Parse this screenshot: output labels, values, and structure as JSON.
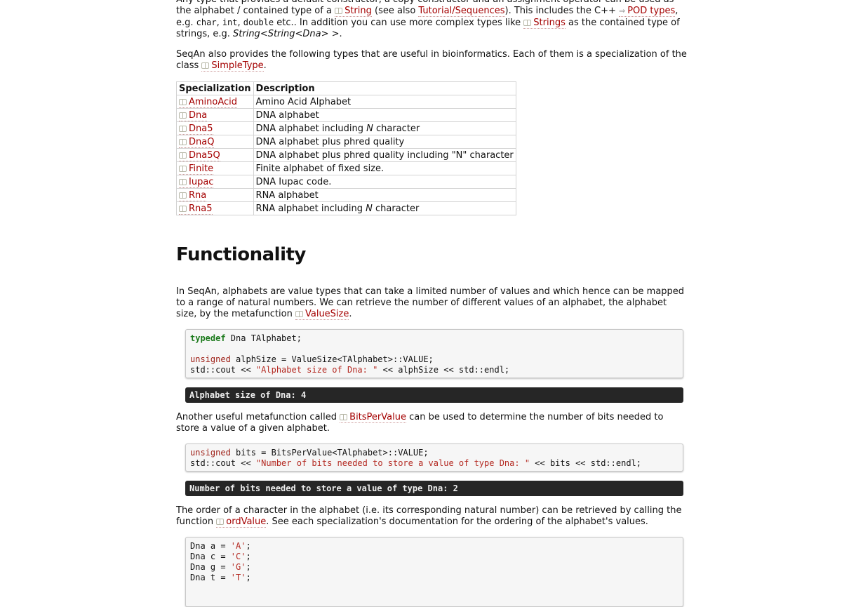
{
  "intro": {
    "p1_a": "Any type that provides a default constructor, a copy constructor and an assignment operator can be used as the alphabet / contained type of a ",
    "p1_string": "String",
    "p1_b": " (see also ",
    "p1_tutorial": "Tutorial/Sequences",
    "p1_c": "). This includes the C++ ",
    "p1_pod": "POD types",
    "p1_d": ", e.g. ",
    "p1_char": "char",
    "p1_sep1": ", ",
    "p1_int": "int",
    "p1_sep2": ", ",
    "p1_double": "double",
    "p1_e": " etc.. In addition you can use more complex types like ",
    "p1_strings": "Strings",
    "p1_f": " as the contained type of strings, e.g. ",
    "p1_example": "String<String<Dna> >",
    "p1_g": ".",
    "p2_a": "SeqAn also provides the following types that are useful in bioinformatics. Each of them is a specialization of the class ",
    "p2_simpletype": "SimpleType",
    "p2_b": "."
  },
  "table": {
    "headers": [
      "Specialization",
      "Description"
    ],
    "rows": [
      {
        "name": "AminoAcid",
        "desc": "Amino Acid Alphabet"
      },
      {
        "name": "Dna",
        "desc": "DNA alphabet"
      },
      {
        "name": "Dna5",
        "desc_a": "DNA alphabet including ",
        "desc_em": "N",
        "desc_b": " character"
      },
      {
        "name": "DnaQ",
        "desc": "DNA alphabet plus phred quality"
      },
      {
        "name": "Dna5Q",
        "desc": "DNA alphabet plus phred quality including \"N\" character"
      },
      {
        "name": "Finite",
        "desc": "Finite alphabet of fixed size."
      },
      {
        "name": "Iupac",
        "desc": "DNA Iupac code."
      },
      {
        "name": "Rna",
        "desc": "RNA alphabet"
      },
      {
        "name": "Rna5",
        "desc_a": "RNA alphabet including ",
        "desc_em": "N",
        "desc_b": " character"
      }
    ]
  },
  "functionality": {
    "heading": "Functionality",
    "p1_a": "In SeqAn, alphabets are value types that can take a limited number of values and which hence can be mapped to a range of natural numbers. We can retrieve the number of different values of an alphabet, the alphabet size, by the metafunction ",
    "p1_valuesize": "ValueSize",
    "p1_b": ".",
    "code1": {
      "l1_kw": "typedef",
      "l1_rest": " Dna TAlphabet;",
      "l3_kw": "unsigned",
      "l3_rest": " alphSize = ValueSize<TAlphabet>::VALUE;",
      "l4_a": "std::cout << ",
      "l4_str": "\"Alphabet size of Dna: \"",
      "l4_b": " << alphSize << std::endl;"
    },
    "out1": "Alphabet size of Dna: 4",
    "p2_a": "Another useful metafunction called ",
    "p2_bitspervalue": "BitsPerValue",
    "p2_b": " can be used to determine the number of bits needed to store a value of a given alphabet.",
    "code2": {
      "l1_kw": "unsigned",
      "l1_rest": " bits = BitsPerValue<TAlphabet>::VALUE;",
      "l2_a": "std::cout << ",
      "l2_str": "\"Number of bits needed to store a value of type Dna: \"",
      "l2_b": " << bits << std::endl;"
    },
    "out2": "Number of bits needed to store a value of type Dna: 2",
    "p3_a": "The order of a character in the alphabet (i.e. its corresponding natural number) can be retrieved by calling the function ",
    "p3_ordvalue": "ordValue",
    "p3_b": ". See each specialization's documentation for the ordering of the alphabet's values.",
    "code3": [
      {
        "a": "Dna a = ",
        "s": "'A'",
        "b": ";"
      },
      {
        "a": "Dna c = ",
        "s": "'C'",
        "b": ";"
      },
      {
        "a": "Dna g = ",
        "s": "'G'",
        "b": ";"
      },
      {
        "a": "Dna t = ",
        "s": "'T'",
        "b": ";"
      }
    ]
  }
}
